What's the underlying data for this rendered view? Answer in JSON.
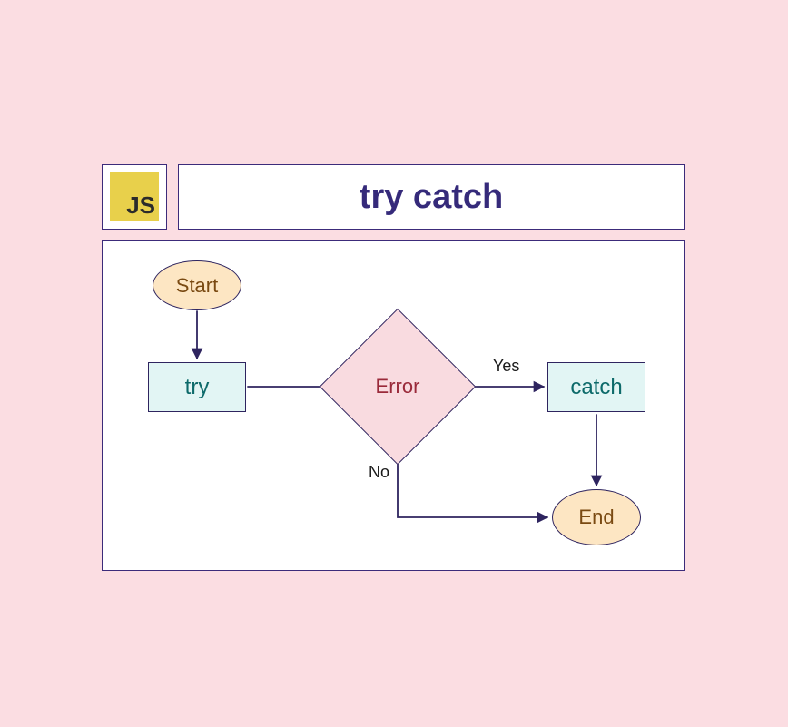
{
  "logo": {
    "text": "JS"
  },
  "title": "try catch",
  "nodes": {
    "start": "Start",
    "try": "try",
    "error": "Error",
    "catch": "catch",
    "end": "End"
  },
  "edges": {
    "yes": "Yes",
    "no": "No"
  },
  "colors": {
    "background": "#fbdde2",
    "border": "#3c2b7a",
    "logo_bg": "#e8d04b",
    "title_text": "#352a7a",
    "terminal_fill": "#fde6c3",
    "terminal_text": "#7a4a12",
    "process_fill": "#e2f5f4",
    "process_text": "#0d6a6a",
    "decision_fill": "#f9dbe0",
    "decision_text": "#9a2a3a"
  }
}
